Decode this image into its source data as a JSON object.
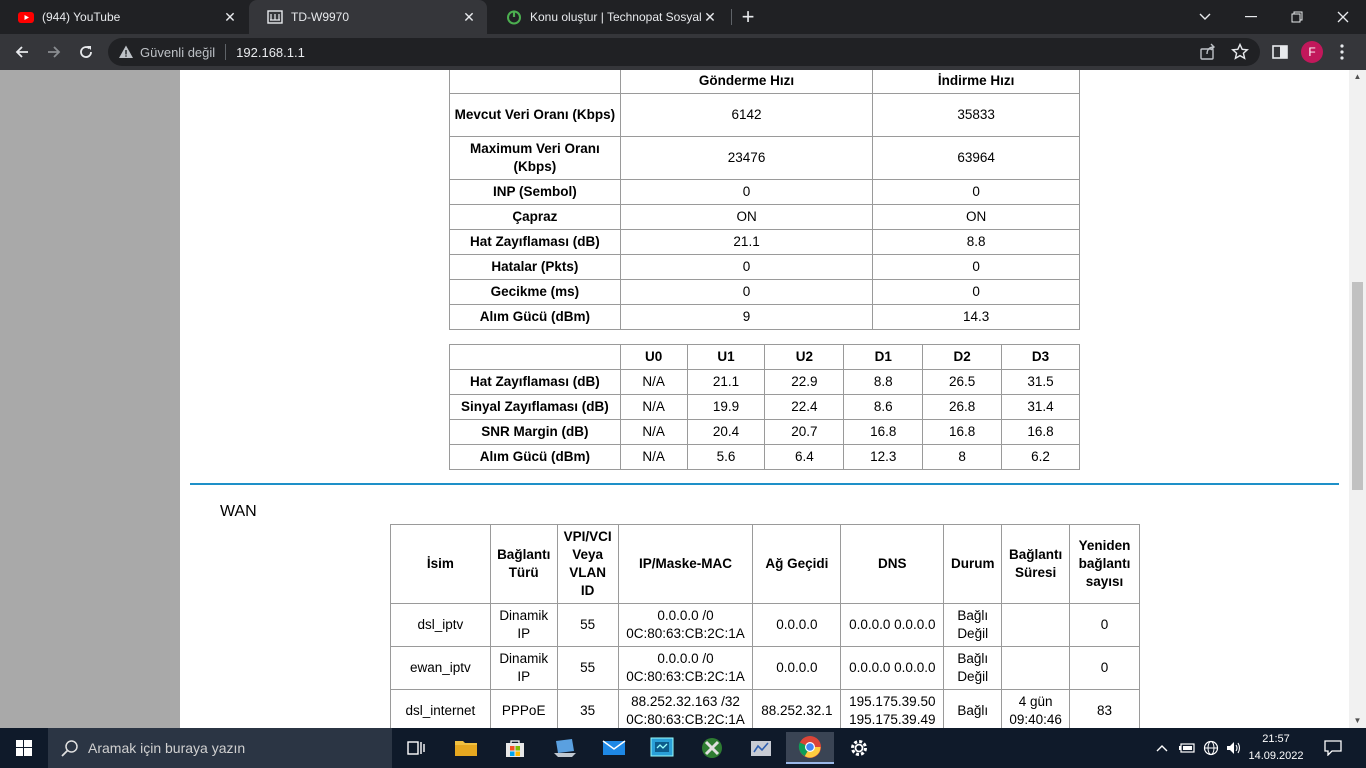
{
  "browser": {
    "tabs": [
      {
        "title": "(944) YouTube",
        "icon": "youtube-icon"
      },
      {
        "title": "TD-W9970",
        "icon": "tplink-icon"
      },
      {
        "title": "Konu oluştur | Technopat Sosyal",
        "icon": "technopat-icon"
      }
    ],
    "security_label": "Güvenli değil",
    "url": "192.168.1.1",
    "profile_initial": "F"
  },
  "line_stats": {
    "headers": [
      "",
      "Gönderme Hızı",
      "İndirme Hızı"
    ],
    "rows": [
      {
        "label": "Mevcut Veri Oranı (Kbps)",
        "up": "6142",
        "down": "35833"
      },
      {
        "label": "Maximum Veri Oranı (Kbps)",
        "up": "23476",
        "down": "63964"
      },
      {
        "label": "INP (Sembol)",
        "up": "0",
        "down": "0"
      },
      {
        "label": "Çapraz",
        "up": "ON",
        "down": "ON"
      },
      {
        "label": "Hat Zayıflaması (dB)",
        "up": "21.1",
        "down": "8.8"
      },
      {
        "label": "Hatalar (Pkts)",
        "up": "0",
        "down": "0"
      },
      {
        "label": "Gecikme (ms)",
        "up": "0",
        "down": "0"
      },
      {
        "label": "Alım Gücü (dBm)",
        "up": "9",
        "down": "14.3"
      }
    ]
  },
  "band_stats": {
    "headers": [
      "",
      "U0",
      "U1",
      "U2",
      "D1",
      "D2",
      "D3"
    ],
    "rows": [
      {
        "label": "Hat Zayıflaması (dB)",
        "values": [
          "N/A",
          "21.1",
          "22.9",
          "8.8",
          "26.5",
          "31.5"
        ]
      },
      {
        "label": "Sinyal Zayıflaması (dB)",
        "values": [
          "N/A",
          "19.9",
          "22.4",
          "8.6",
          "26.8",
          "31.4"
        ]
      },
      {
        "label": "SNR Margin (dB)",
        "values": [
          "N/A",
          "20.4",
          "20.7",
          "16.8",
          "16.8",
          "16.8"
        ]
      },
      {
        "label": "Alım Gücü (dBm)",
        "values": [
          "N/A",
          "5.6",
          "6.4",
          "12.3",
          "8",
          "6.2"
        ]
      }
    ]
  },
  "wan": {
    "title": "WAN",
    "headers": {
      "name": "İsim",
      "type": "Bağlantı Türü",
      "vpi": "VPI/VCI Veya VLAN ID",
      "ip": "IP/Maske-MAC",
      "gateway": "Ağ Geçidi",
      "dns": "DNS",
      "status": "Durum",
      "uptime": "Bağlantı Süresi",
      "reconnect": "Yeniden bağlantı sayısı"
    },
    "rows": [
      {
        "name": "dsl_iptv",
        "type": "Dinamik IP",
        "vpi": "55",
        "ip": "0.0.0.0 /0",
        "mac": "0C:80:63:CB:2C:1A",
        "gateway": "0.0.0.0",
        "dns": "0.0.0.0 0.0.0.0",
        "status": "Bağlı Değil",
        "uptime": "",
        "reconnect": "0"
      },
      {
        "name": "ewan_iptv",
        "type": "Dinamik IP",
        "vpi": "55",
        "ip": "0.0.0.0 /0",
        "mac": "0C:80:63:CB:2C:1A",
        "gateway": "0.0.0.0",
        "dns": "0.0.0.0 0.0.0.0",
        "status": "Bağlı Değil",
        "uptime": "",
        "reconnect": "0"
      },
      {
        "name": "dsl_internet",
        "type": "PPPoE",
        "vpi": "35",
        "ip": "88.252.32.163 /32",
        "mac": "0C:80:63:CB:2C:1A",
        "gateway": "88.252.32.1",
        "dns": "195.175.39.50 195.175.39.49",
        "status": "Bağlı",
        "uptime": "4 gün 09:40:46",
        "reconnect": "83"
      }
    ]
  },
  "taskbar": {
    "search_placeholder": "Aramak için buraya yazın",
    "time": "21:57",
    "date": "14.09.2022"
  }
}
